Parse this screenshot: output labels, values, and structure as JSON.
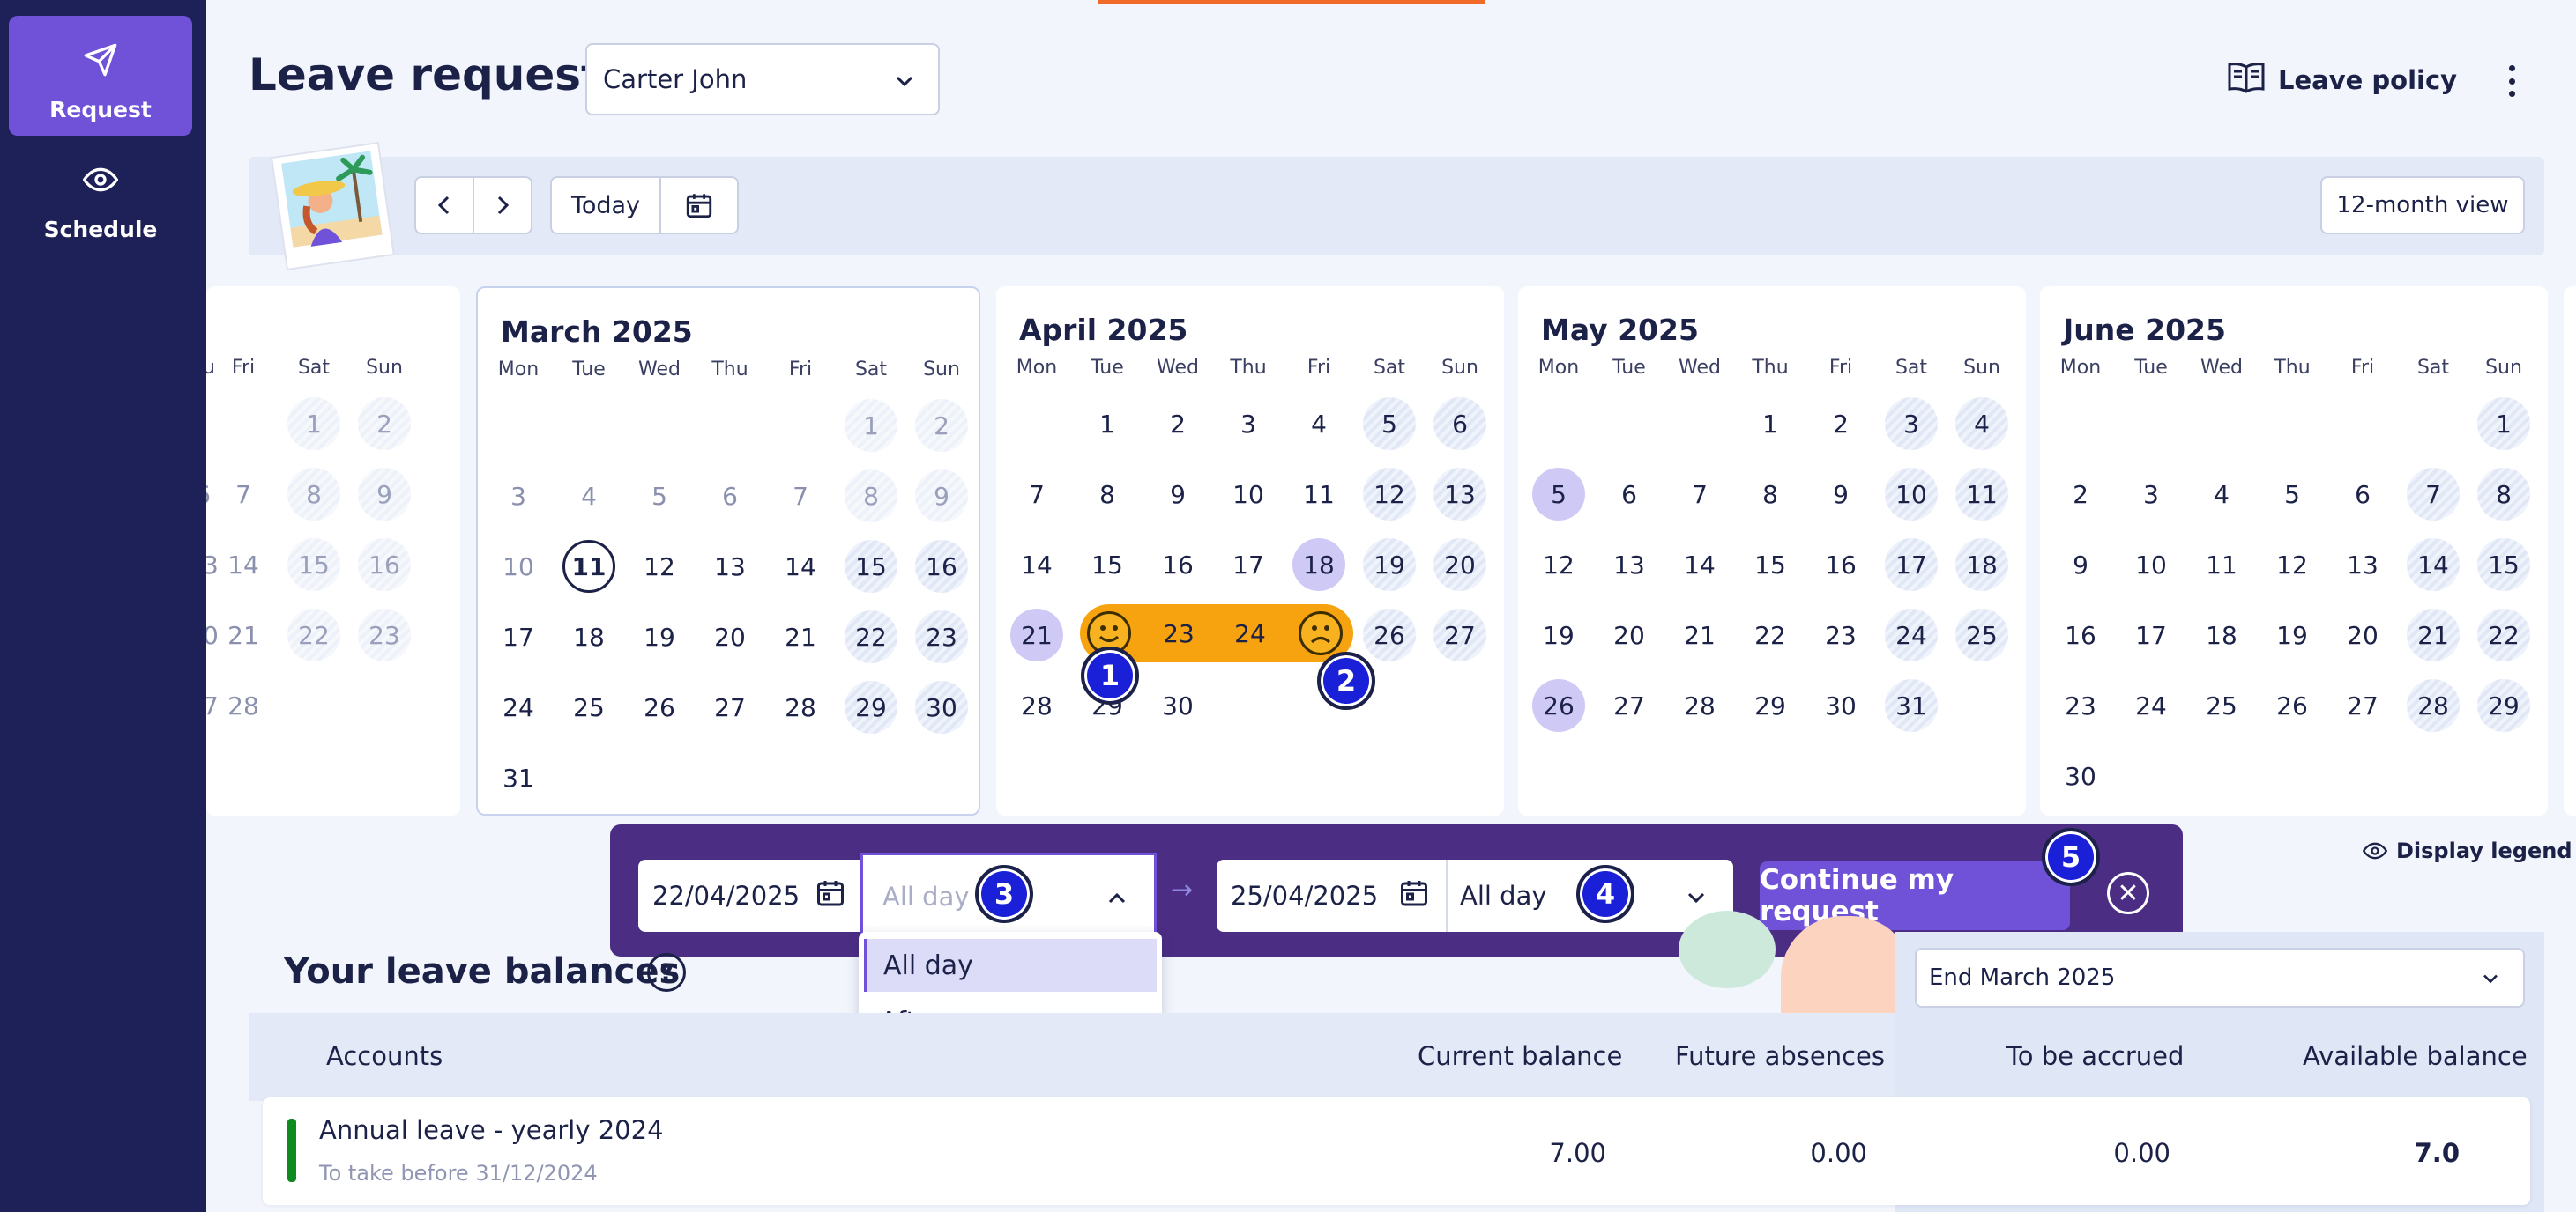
{
  "sidebar": {
    "items": [
      {
        "label": "Request",
        "icon": "send-icon",
        "active": true
      },
      {
        "label": "Schedule",
        "icon": "eye-icon",
        "active": false
      }
    ]
  },
  "header": {
    "title": "Leave request",
    "employee": "Carter John",
    "leave_policy": "Leave policy"
  },
  "toolbar": {
    "today": "Today",
    "twelve_month": "12-month view"
  },
  "calendar": {
    "weekdays": [
      "Mon",
      "Tue",
      "Wed",
      "Thu",
      "Fri",
      "Sat",
      "Sun"
    ],
    "partial_weekdays": [
      "hu",
      "Fri",
      "Sat",
      "Sun"
    ],
    "months": [
      {
        "title": "",
        "partial": true
      },
      {
        "title": "March 2025"
      },
      {
        "title": "April 2025"
      },
      {
        "title": "May 2025"
      },
      {
        "title": "June 2025"
      }
    ],
    "today": "11",
    "selected_range": {
      "start": "22/04/2025",
      "end": "25/04/2025"
    }
  },
  "request_bar": {
    "start_date": "22/04/2025",
    "start_period": "All day",
    "end_date": "25/04/2025",
    "end_period": "All day",
    "continue": "Continue my request",
    "close": "✕"
  },
  "dropdown": {
    "options": [
      "All day",
      "Afternoon"
    ],
    "selected": "All day"
  },
  "annotations": [
    "1",
    "2",
    "3",
    "4",
    "5"
  ],
  "display_legend": "Display legend",
  "balances": {
    "title": "Your leave balances",
    "period": "End March 2025",
    "columns": [
      "Accounts",
      "Current balance",
      "Future absences",
      "To be accrued",
      "Available balance"
    ],
    "rows": [
      {
        "name": "Annual leave - yearly 2024",
        "subtitle": "To take before 31/12/2024",
        "current": "7.00",
        "future": "0.00",
        "accrued": "0.00",
        "available": "7.0",
        "color": "#0f8a1e"
      }
    ]
  },
  "colors": {
    "sidebar": "#1e2157",
    "accent": "#6f52d8",
    "range": "#f6a30f",
    "holiday": "#cfc9f6",
    "request_bar": "#4b2e84",
    "badge": "#1a1fd8"
  }
}
